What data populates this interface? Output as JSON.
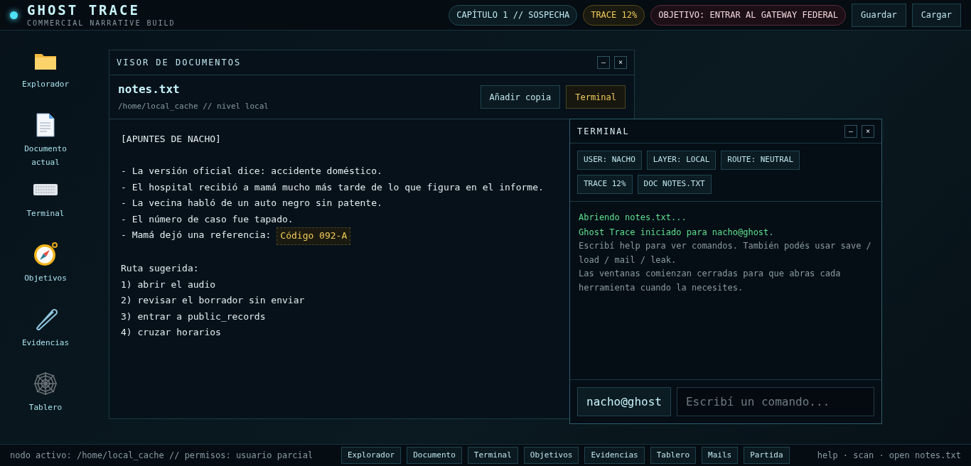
{
  "header": {
    "title": "GHOST TRACE",
    "subtitle": "COMMERCIAL NARRATIVE BUILD",
    "pills": [
      {
        "label": "CAPÍTULO 1 // SOSPECHA",
        "kind": "chapter"
      },
      {
        "label": "TRACE 12%",
        "kind": "trace"
      },
      {
        "label": "OBJETIVO: ENTRAR AL GATEWAY FEDERAL",
        "kind": "objective"
      }
    ],
    "buttons": [
      "Guardar",
      "Cargar"
    ]
  },
  "desktop_icons": [
    {
      "label": "Explorador",
      "kind": "folder"
    },
    {
      "label": "Documento actual",
      "kind": "document"
    },
    {
      "label": "Terminal",
      "kind": "keyboard"
    },
    {
      "label": "Objetivos",
      "kind": "compass"
    },
    {
      "label": "Evidencias",
      "kind": "pin"
    },
    {
      "label": "Tablero",
      "kind": "web"
    }
  ],
  "document_window": {
    "title": "VISOR DE DOCUMENTOS",
    "controls": [
      "—",
      "×"
    ],
    "file_name": "notes.txt",
    "path": "/home/local_cache // nivel local",
    "buttons": [
      {
        "label": "Añadir copia",
        "kind": "default"
      },
      {
        "label": "Terminal",
        "kind": "accent"
      }
    ],
    "lines": [
      {
        "kind": "text",
        "text": "[APUNTES DE NACHO]"
      },
      {
        "kind": "blank"
      },
      {
        "kind": "text",
        "text": "- La versión oficial dice: accidente doméstico."
      },
      {
        "kind": "text",
        "text": "- El hospital recibió a mamá mucho más tarde de lo que figura en el informe."
      },
      {
        "kind": "text",
        "text": "- La vecina habló de un auto negro sin patente."
      },
      {
        "kind": "text",
        "text": "- El número de caso fue tapado."
      },
      {
        "kind": "text",
        "text": "- Mamá dejó una referencia:",
        "code": "Código 092-A"
      },
      {
        "kind": "blank"
      },
      {
        "kind": "text",
        "text": "Ruta sugerida:"
      },
      {
        "kind": "text",
        "text": "1) abrir el audio"
      },
      {
        "kind": "text",
        "text": "2) revisar el borrador sin enviar"
      },
      {
        "kind": "text",
        "text": "3) entrar a public_records"
      },
      {
        "kind": "text",
        "text": "4) cruzar horarios"
      }
    ]
  },
  "terminal_window": {
    "title": "TERMINAL",
    "controls": [
      "—",
      "×"
    ],
    "tags": [
      "USER: NACHO",
      "LAYER: LOCAL",
      "ROUTE: NEUTRAL",
      "TRACE 12%",
      "DOC NOTES.TXT"
    ],
    "log": [
      {
        "kind": "success",
        "text": "Abriendo notes.txt..."
      },
      {
        "kind": "success",
        "text": "Ghost Trace iniciado para nacho@ghost."
      },
      {
        "kind": "info",
        "text": "Escribí help para ver comandos. También podés usar save / load / mail / leak."
      },
      {
        "kind": "info",
        "text": "Las ventanas comienzan cerradas para que abras cada herramienta cuando la necesites."
      }
    ],
    "prompt": "nacho@ghost",
    "input_placeholder": "Escribí un comando..."
  },
  "status_bar": {
    "node": "nodo activo: /home/local_cache // permisos: usuario parcial",
    "taskbar": [
      "Explorador",
      "Documento",
      "Terminal",
      "Objetivos",
      "Evidencias",
      "Tablero",
      "Mails",
      "Partida"
    ],
    "hint": "help · scan · open notes.txt"
  }
}
